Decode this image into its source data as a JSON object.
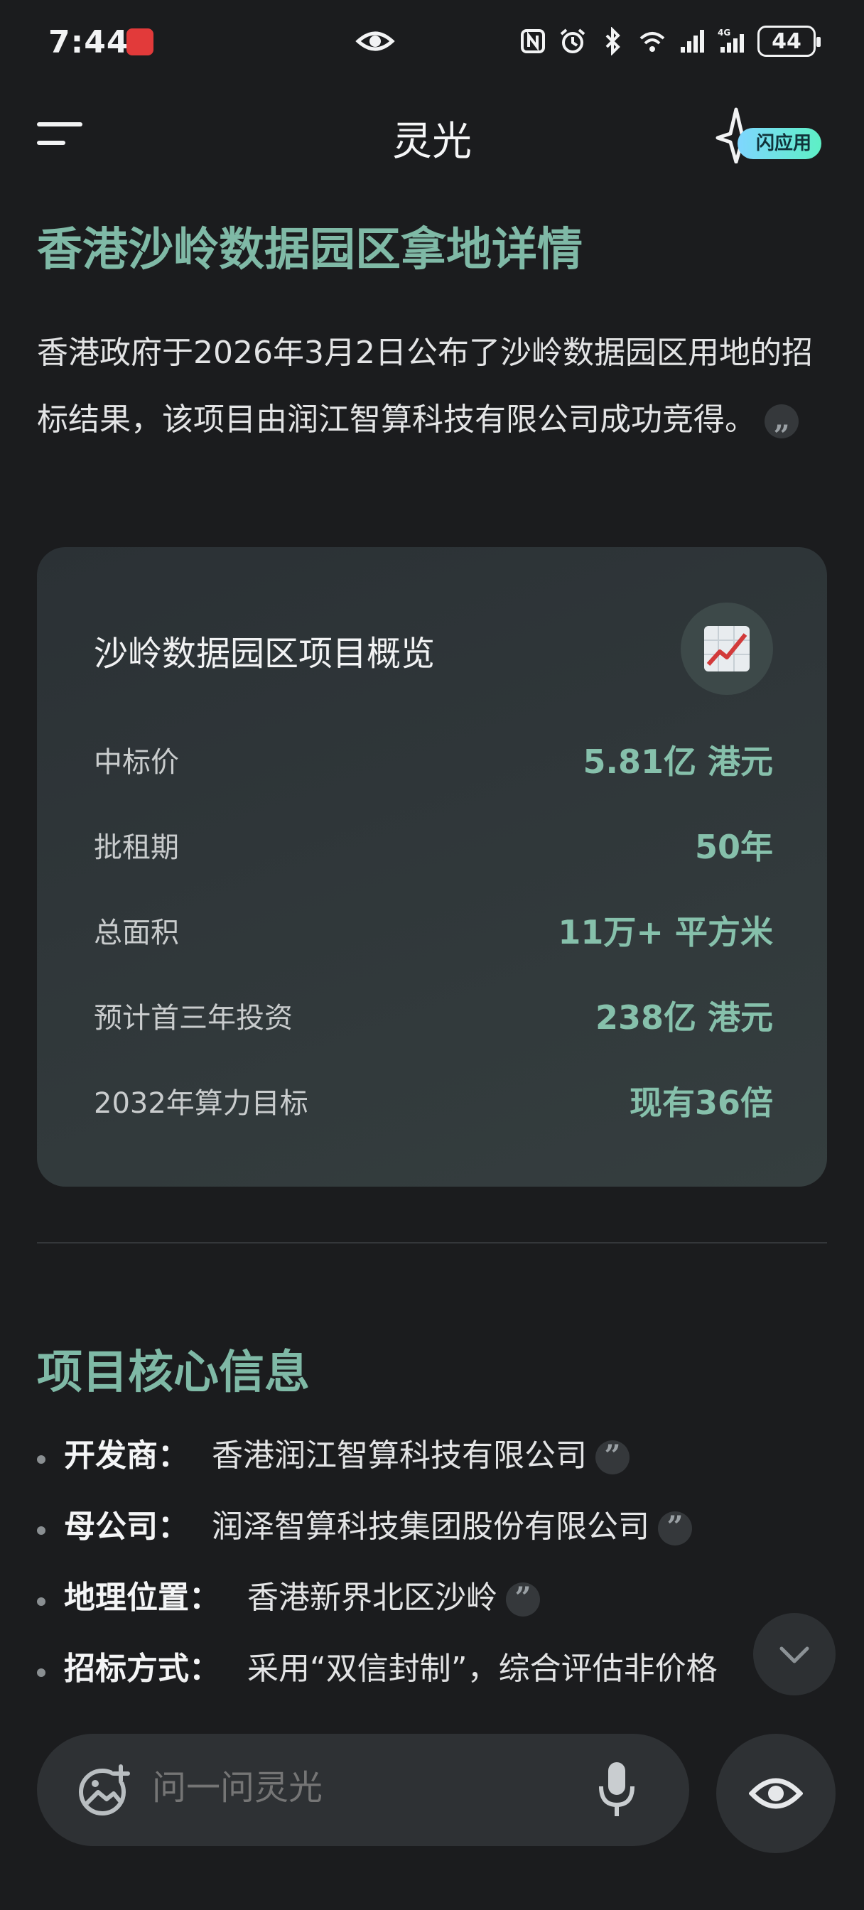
{
  "status_bar": {
    "time": "7:44",
    "battery": "44",
    "network_label": "4G"
  },
  "header": {
    "title": "灵光",
    "flash_app_label": "闪应用"
  },
  "article": {
    "title": "香港沙岭数据园区拿地详情",
    "intro": "香港政府于2026年3月2日公布了沙岭数据园区用地的招标结果，该项目由润江智算科技有限公司成功竞得。"
  },
  "card": {
    "title": "沙岭数据园区项目概览",
    "rows": [
      {
        "label": "中标价",
        "value": "5.81亿 港元"
      },
      {
        "label": "批租期",
        "value": "50年"
      },
      {
        "label": "总面积",
        "value": "11万+ 平方米"
      },
      {
        "label": "预计首三年投资",
        "value": "238亿 港元"
      },
      {
        "label": "2032年算力目标",
        "value": "现有36倍"
      }
    ]
  },
  "section": {
    "title": "项目核心信息",
    "items": [
      {
        "key": "开发商：",
        "value": "香港润江智算科技有限公司"
      },
      {
        "key": "母公司：",
        "value": "润泽智算科技集团股份有限公司"
      },
      {
        "key": "地理位置：",
        "value": "香港新界北区沙岭"
      },
      {
        "key": "招标方式：",
        "value": "采用“双信封制”，综合评估非价格"
      }
    ]
  },
  "input": {
    "placeholder": "问一问灵光"
  },
  "colors": {
    "accent": "#7fb9a6",
    "background": "#1b1c1e",
    "card": "#2f3638"
  },
  "icons": [
    "menu-icon",
    "flash-icon",
    "chart-emoji-icon",
    "citation-icon",
    "chevron-down-icon",
    "image-add-icon",
    "microphone-icon",
    "eye-icon"
  ]
}
